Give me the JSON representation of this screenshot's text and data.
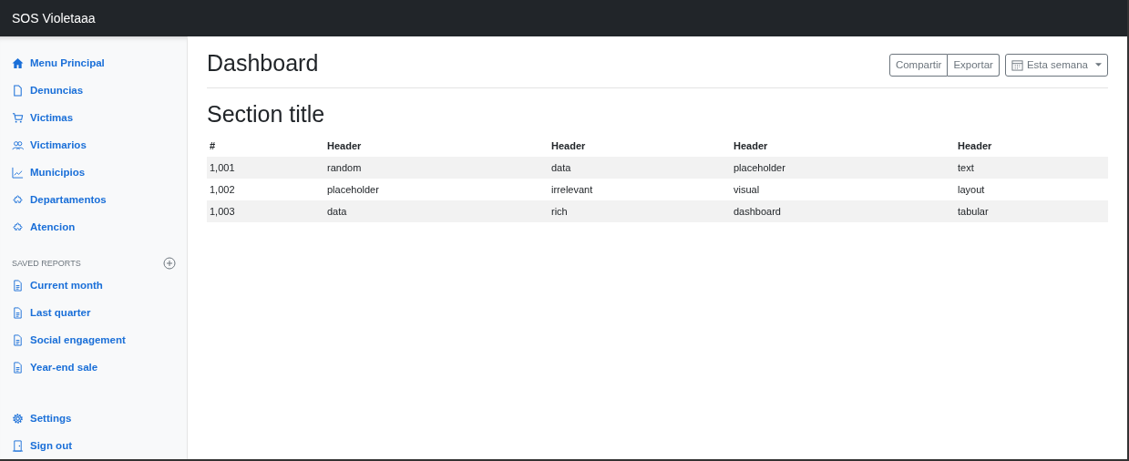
{
  "navbar": {
    "brand": "SOS Violetaaa"
  },
  "sidebar": {
    "items": [
      {
        "label": "Menu Principal"
      },
      {
        "label": "Denuncias"
      },
      {
        "label": "Victimas"
      },
      {
        "label": "Victimarios"
      },
      {
        "label": "Municipios"
      },
      {
        "label": "Departamentos"
      },
      {
        "label": "Atencion"
      }
    ],
    "saved_reports": {
      "heading": "SAVED REPORTS",
      "items": [
        {
          "label": "Current month"
        },
        {
          "label": "Last quarter"
        },
        {
          "label": "Social engagement"
        },
        {
          "label": "Year-end sale"
        }
      ]
    },
    "footer_items": [
      {
        "label": "Settings"
      },
      {
        "label": "Sign out"
      }
    ]
  },
  "main": {
    "title": "Dashboard",
    "buttons": [
      "Compartir",
      "Exportar"
    ],
    "period": "Esta semana",
    "section_title": "Section title",
    "table": {
      "columns": [
        "#",
        "Header",
        "Header",
        "Header",
        "Header"
      ],
      "rows": [
        [
          "1,001",
          "random",
          "data",
          "placeholder",
          "text"
        ],
        [
          "1,002",
          "placeholder",
          "irrelevant",
          "visual",
          "layout"
        ],
        [
          "1,003",
          "data",
          "rich",
          "dashboard",
          "tabular"
        ]
      ]
    }
  }
}
